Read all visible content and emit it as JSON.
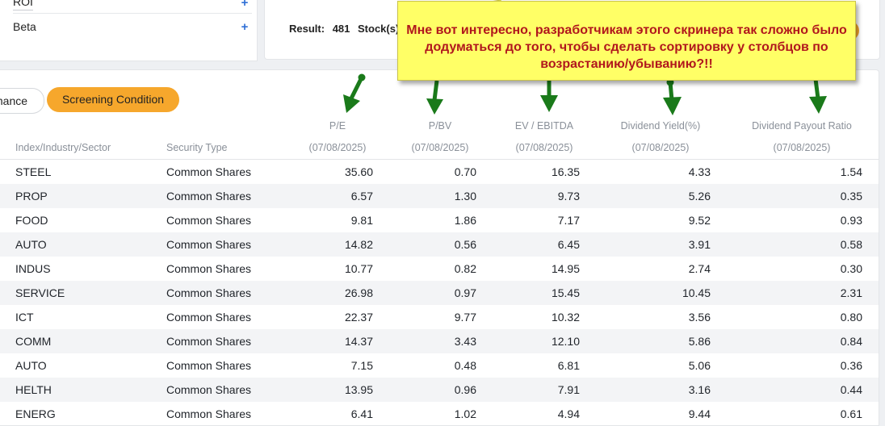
{
  "filters": [
    {
      "label": "ROI",
      "action": "+"
    },
    {
      "label": "Beta",
      "action": "+"
    }
  ],
  "result": {
    "label": "Result:",
    "count": "481",
    "unit": "Stock(s)"
  },
  "tabs": {
    "performance": "mance",
    "screening": "Screening Condition"
  },
  "table": {
    "columns": [
      {
        "key": "sector",
        "label": "Index/Industry/Sector"
      },
      {
        "key": "type",
        "label": "Security Type"
      },
      {
        "key": "pe",
        "label": "P/E",
        "date": "(07/08/2025)"
      },
      {
        "key": "pbv",
        "label": "P/BV",
        "date": "(07/08/2025)"
      },
      {
        "key": "ev",
        "label": "EV / EBITDA",
        "date": "(07/08/2025)"
      },
      {
        "key": "dy",
        "label": "Dividend Yield(%)",
        "date": "(07/08/2025)"
      },
      {
        "key": "dpr",
        "label": "Dividend Payout Ratio",
        "date": "(07/08/2025)"
      }
    ],
    "rows": [
      {
        "sector": "STEEL",
        "type": "Common Shares",
        "pe": "35.60",
        "pbv": "0.70",
        "ev": "16.35",
        "dy": "4.33",
        "dpr": "1.54"
      },
      {
        "sector": "PROP",
        "type": "Common Shares",
        "pe": "6.57",
        "pbv": "1.30",
        "ev": "9.73",
        "dy": "5.26",
        "dpr": "0.35"
      },
      {
        "sector": "FOOD",
        "type": "Common Shares",
        "pe": "9.81",
        "pbv": "1.86",
        "ev": "7.17",
        "dy": "9.52",
        "dpr": "0.93"
      },
      {
        "sector": "AUTO",
        "type": "Common Shares",
        "pe": "14.82",
        "pbv": "0.56",
        "ev": "6.45",
        "dy": "3.91",
        "dpr": "0.58"
      },
      {
        "sector": "INDUS",
        "type": "Common Shares",
        "pe": "10.77",
        "pbv": "0.82",
        "ev": "14.95",
        "dy": "2.74",
        "dpr": "0.30"
      },
      {
        "sector": "SERVICE",
        "type": "Common Shares",
        "pe": "26.98",
        "pbv": "0.97",
        "ev": "15.45",
        "dy": "10.45",
        "dpr": "2.31"
      },
      {
        "sector": "ICT",
        "type": "Common Shares",
        "pe": "22.37",
        "pbv": "9.77",
        "ev": "10.32",
        "dy": "3.56",
        "dpr": "0.80"
      },
      {
        "sector": "COMM",
        "type": "Common Shares",
        "pe": "14.37",
        "pbv": "3.43",
        "ev": "12.10",
        "dy": "5.86",
        "dpr": "0.84"
      },
      {
        "sector": "AUTO",
        "type": "Common Shares",
        "pe": "7.15",
        "pbv": "0.48",
        "ev": "6.81",
        "dy": "5.06",
        "dpr": "0.36"
      },
      {
        "sector": "HELTH",
        "type": "Common Shares",
        "pe": "13.95",
        "pbv": "0.96",
        "ev": "7.91",
        "dy": "3.16",
        "dpr": "0.44"
      },
      {
        "sector": "ENERG",
        "type": "Common Shares",
        "pe": "6.41",
        "pbv": "1.02",
        "ev": "4.94",
        "dy": "9.44",
        "dpr": "0.61"
      }
    ]
  },
  "annotation": {
    "lines": [
      "Мне вот интересно, разработчикам этого скринера так сложно было",
      "додуматься до того, чтобы сделать сортировку у столбцов по",
      "возрастанию/убыванию?!!"
    ]
  },
  "colors": {
    "accent": "#f6a72c",
    "arrow": "#1a7a1a",
    "note_bg": "#ffff66",
    "note_text": "#b1171d",
    "plus": "#2f6fd6"
  }
}
